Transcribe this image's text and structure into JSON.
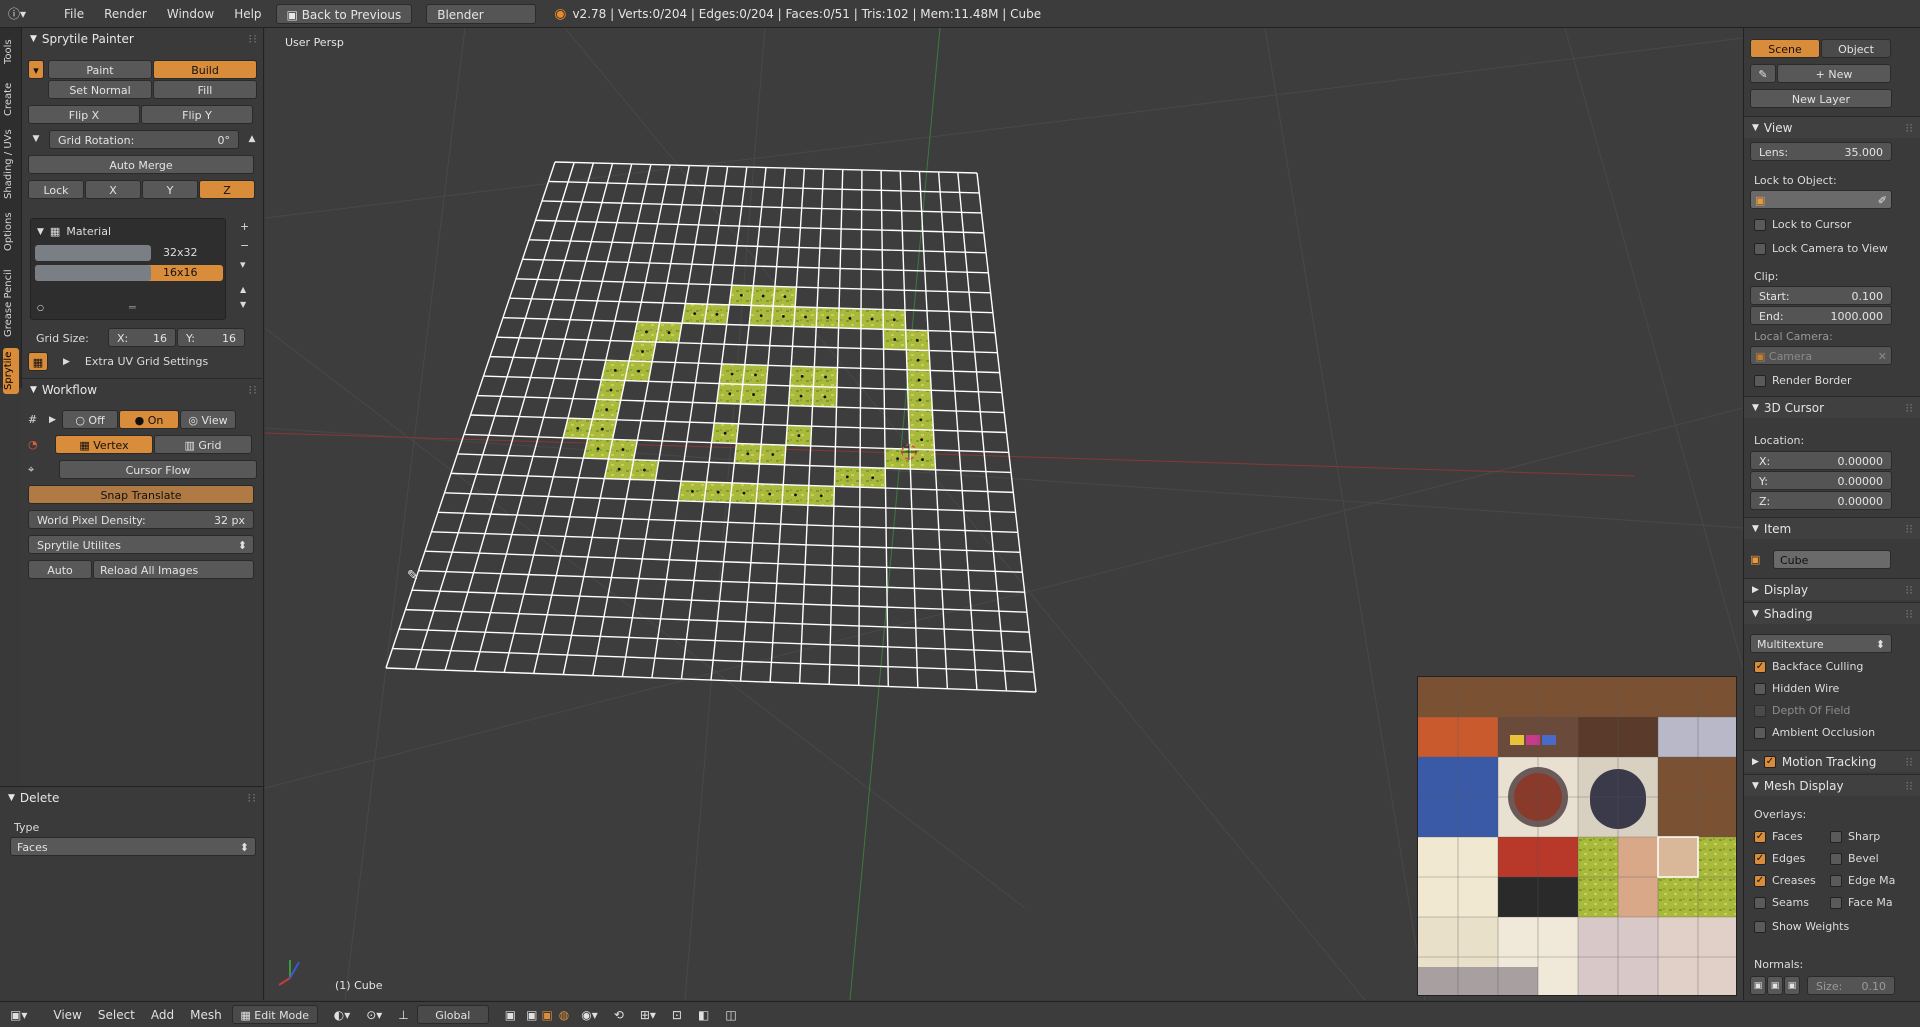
{
  "topbar": {
    "menus": [
      "File",
      "Render",
      "Window",
      "Help"
    ],
    "back_button": "Back to Previous",
    "engine": "Blender Render",
    "stats": "v2.78 | Verts:0/204 | Edges:0/204 | Faces:0/51 | Tris:102 | Mem:11.48M | Cube"
  },
  "left_tabs": [
    "Tools",
    "Create",
    "Shading / UVs",
    "Options",
    "Grease Pencil",
    "Sprytile"
  ],
  "sprytile": {
    "header": "Sprytile Painter",
    "paint": "Paint",
    "build": "Build",
    "set_normal": "Set Normal",
    "fill": "Fill",
    "flip_x": "Flip X",
    "flip_y": "Flip Y",
    "grid_rotation_label": "Grid Rotation:",
    "grid_rotation_value": "0°",
    "auto_merge": "Auto Merge",
    "lock": "Lock",
    "x": "X",
    "y": "Y",
    "z": "Z",
    "material_label": "Material",
    "grid_32": "32x32",
    "grid_16": "16x16",
    "grid_size_label": "Grid Size:",
    "grid_x_label": "X:",
    "grid_x_value": "16",
    "grid_y_label": "Y:",
    "grid_y_value": "16",
    "extra_uv": "Extra UV Grid Settings"
  },
  "workflow": {
    "header": "Workflow",
    "off": "Off",
    "on": "On",
    "view": "View",
    "vertex": "Vertex",
    "grid": "Grid",
    "cursor_flow": "Cursor Flow",
    "snap_translate": "Snap Translate",
    "world_pixel_density_label": "World Pixel Density:",
    "world_pixel_density_value": "32 px",
    "utilities": "Sprytile Utilites",
    "auto": "Auto",
    "reload": "Reload All Images"
  },
  "delete_panel": {
    "header": "Delete",
    "type_label": "Type",
    "type_value": "Faces"
  },
  "viewport": {
    "label": "User Persp",
    "object_label": "(1) Cube"
  },
  "right_panel": {
    "scene_tab": "Scene",
    "object_tab": "Object",
    "new_btn": "New",
    "new_layer": "New Layer",
    "view_header": "View",
    "lens_label": "Lens:",
    "lens_value": "35.000",
    "lock_to_object": "Lock to Object:",
    "lock_to_cursor": "Lock to Cursor",
    "lock_camera": "Lock Camera to View",
    "clip_label": "Clip:",
    "clip_start_label": "Start:",
    "clip_start_value": "0.100",
    "clip_end_label": "End:",
    "clip_end_value": "1000.000",
    "local_camera": "Local Camera:",
    "camera": "Camera",
    "render_border": "Render Border",
    "cursor_header": "3D Cursor",
    "location_label": "Location:",
    "cx_label": "X:",
    "cx_value": "0.00000",
    "cy_label": "Y:",
    "cy_value": "0.00000",
    "cz_label": "Z:",
    "cz_value": "0.00000",
    "item_header": "Item",
    "item_name": "Cube",
    "display_header": "Display",
    "shading_header": "Shading",
    "shading_mode": "Multitexture",
    "backface": "Backface Culling",
    "hidden_wire": "Hidden Wire",
    "dof": "Depth Of Field",
    "ao": "Ambient Occlusion",
    "motion_header": "Motion Tracking",
    "mesh_display_header": "Mesh Display",
    "overlays_label": "Overlays:",
    "faces": "Faces",
    "sharp": "Sharp",
    "edges": "Edges",
    "bevel": "Bevel",
    "creases": "Creases",
    "edge_ma": "Edge Ma",
    "seams": "Seams",
    "face_ma": "Face Ma",
    "show_weights": "Show Weights",
    "normals_label": "Normals:",
    "size_label": "Size:",
    "size_value": "0.10"
  },
  "bottombar": {
    "view": "View",
    "select": "Select",
    "add": "Add",
    "mesh": "Mesh",
    "mode": "Edit Mode",
    "orientation": "Global"
  },
  "colors": {
    "accent": "#d98c3a",
    "grass": "#a6b83a",
    "panel": "#3a3a3a"
  }
}
